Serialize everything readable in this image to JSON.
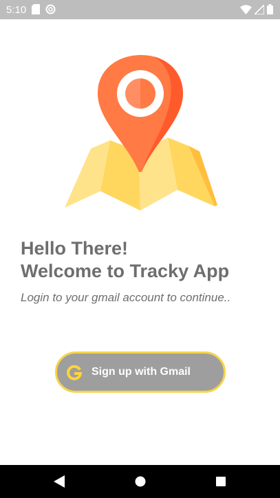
{
  "status_bar": {
    "time": "5:10",
    "left_icons": [
      "sim-card-icon",
      "data-saver-icon"
    ],
    "right_icons": [
      "wifi-icon",
      "signal-icon",
      "battery-icon"
    ]
  },
  "main": {
    "illustration": "map-pin-icon",
    "heading_line1": "Hello There!",
    "heading_line2": "Welcome to Tracky App",
    "subtitle": "Login to your gmail account to continue.."
  },
  "gmail_button": {
    "icon": "google-g-icon",
    "label": "Sign up with Gmail"
  },
  "nav_bar": {
    "buttons": [
      "back-icon",
      "home-icon",
      "recents-icon"
    ]
  },
  "colors": {
    "pin_orange": "#ff7a45",
    "map_yellow": "#ffd75e",
    "button_gray": "#9e9e9e",
    "button_border": "#f6d44a",
    "text_gray": "#6e6e6e"
  }
}
